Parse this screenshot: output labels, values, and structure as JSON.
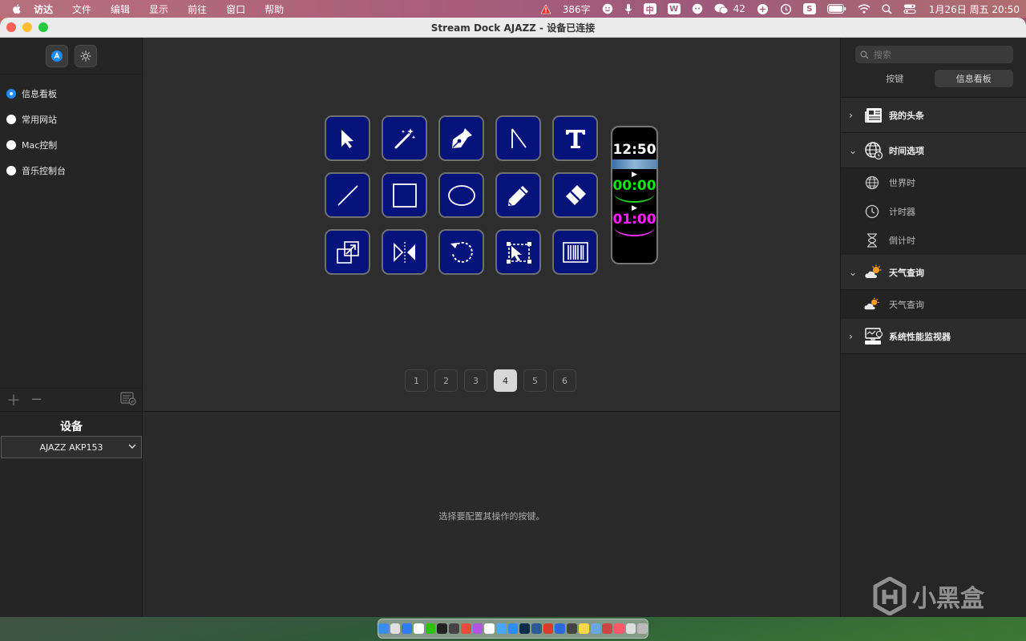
{
  "menubar": {
    "app_name": "访达",
    "items": [
      "文件",
      "编辑",
      "显示",
      "前往",
      "窗口",
      "帮助"
    ],
    "word_count": "386字",
    "wechat_count": "42",
    "datetime": "1月26日 周五  20:50"
  },
  "window": {
    "title": "Stream Dock AJAZZ - 设备已连接"
  },
  "profiles": {
    "items": [
      {
        "label": "信息看板",
        "selected": true
      },
      {
        "label": "常用网站",
        "selected": false
      },
      {
        "label": "Mac控制",
        "selected": false
      },
      {
        "label": "音乐控制台",
        "selected": false
      }
    ]
  },
  "device": {
    "title": "设备",
    "selected": "AJAZZ AKP153"
  },
  "keys": {
    "icons": [
      "cursor-arrow-icon",
      "magic-wand-icon",
      "pen-tool-icon",
      "angle-tool-icon",
      "text-tool-icon",
      "line-tool-icon",
      "rectangle-tool-icon",
      "ellipse-tool-icon",
      "pencil-icon",
      "eraser-icon",
      "resize-icon",
      "flip-icon",
      "rotate-icon",
      "selection-transform-icon",
      "barcode-icon"
    ]
  },
  "strip": {
    "clock": "12:50",
    "timer": "00:00",
    "countdown": "01:00"
  },
  "pager": {
    "pages": [
      "1",
      "2",
      "3",
      "4",
      "5",
      "6"
    ],
    "active": "4"
  },
  "detail": {
    "hint": "选择要配置其操作的按键。"
  },
  "right_panel": {
    "search_placeholder": "搜索",
    "tabs": [
      "按键",
      "信息看板"
    ],
    "active_tab": "信息看板",
    "categories": {
      "my_headlines": "我的头条",
      "time_options": "时间选项",
      "world_clock": "世界时",
      "timer": "计时器",
      "countdown": "倒计时",
      "weather": "天气查询",
      "weather_sub": "天气查询",
      "sysmon": "系统性能监视器"
    }
  },
  "watermark": {
    "text": "小黑盒"
  }
}
